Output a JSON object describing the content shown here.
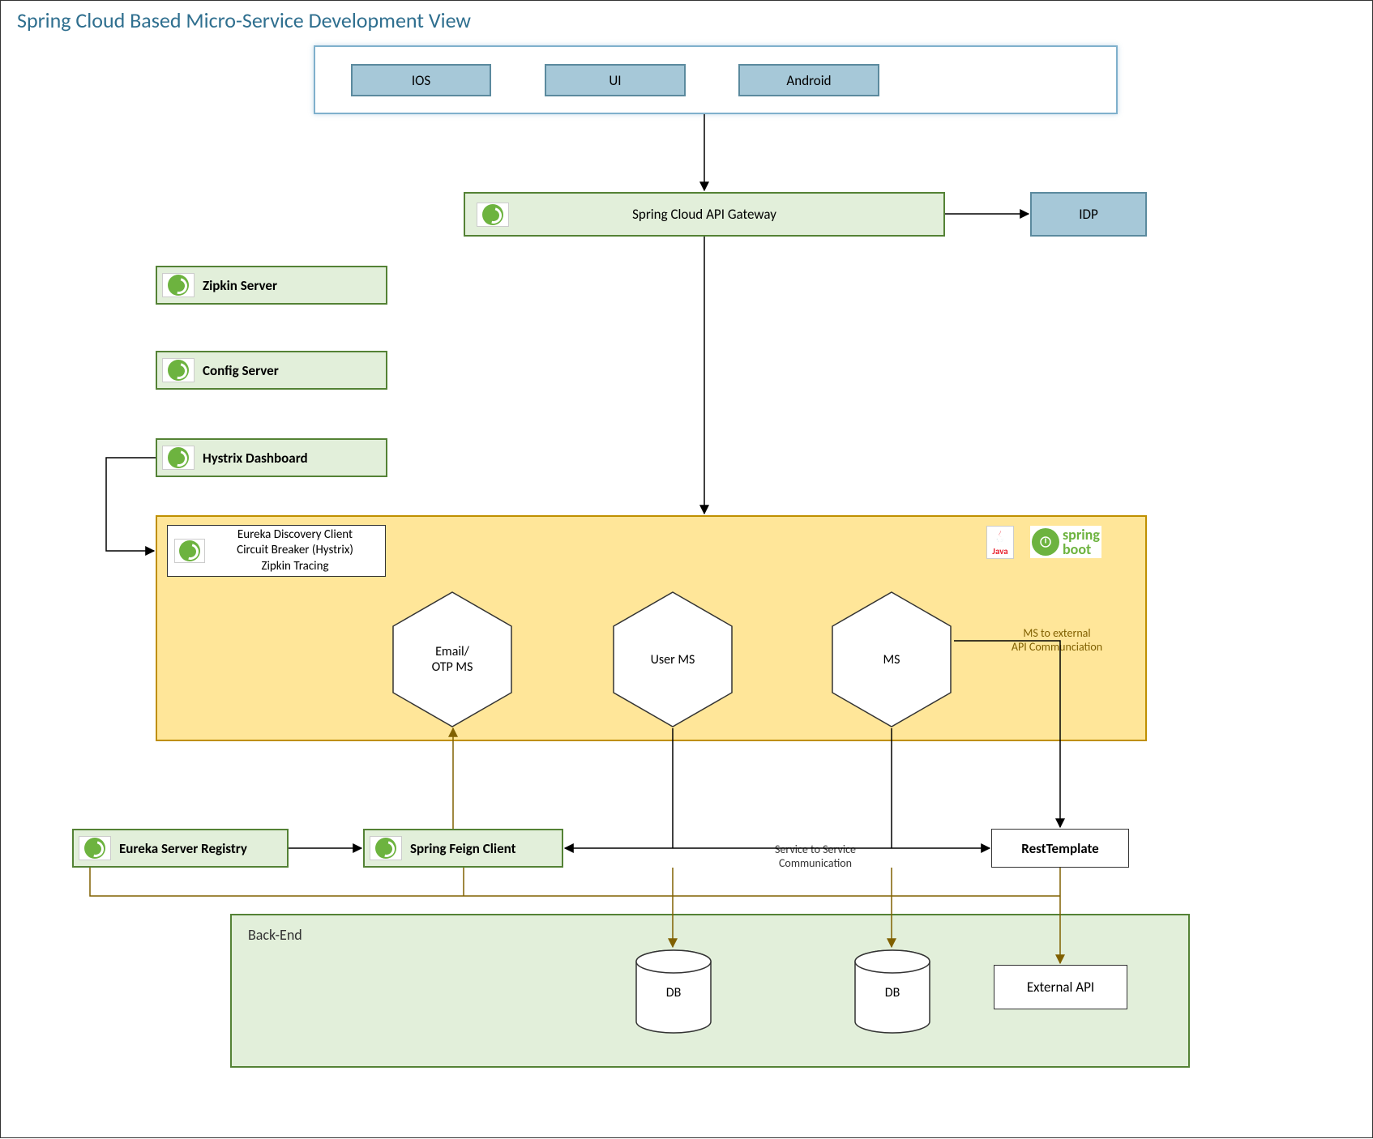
{
  "title": "Spring Cloud Based Micro-Service Development View",
  "clients": {
    "ios": "IOS",
    "ui": "UI",
    "android": "Android"
  },
  "gateway": "Spring Cloud API Gateway",
  "idp": "IDP",
  "sidebar": {
    "zipkin": "Zipkin Server",
    "config": "Config Server",
    "hystrix": "Hystrix Dashboard"
  },
  "ms_info": {
    "line1": "Eureka Discovery Client",
    "line2": "Circuit Breaker (Hystrix)",
    "line3": "Zipkin Tracing"
  },
  "hex": {
    "email": "Email/\nOTP MS",
    "user": "User MS",
    "ms": "MS"
  },
  "logos": {
    "java": "Java",
    "springboot": "spring\nboot"
  },
  "labels": {
    "ms_external": "MS to external\nAPI Communciation",
    "svc_to_svc": "Service to Service\nCommunication"
  },
  "eureka_registry": "Eureka Server Registry",
  "feign": "Spring Feign Client",
  "rest_template": "RestTemplate",
  "backend": {
    "label": "Back-End",
    "db1": "DB",
    "db2": "DB",
    "external_api": "External API"
  }
}
